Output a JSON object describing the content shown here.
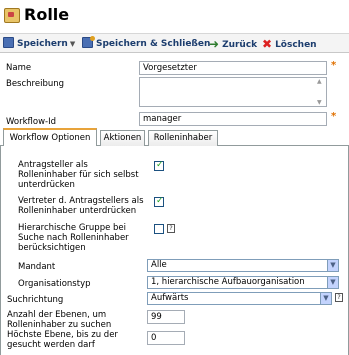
{
  "header": {
    "title": "Rolle"
  },
  "toolbar": {
    "save": "Speichern",
    "save_close": "Speichern & Schließen",
    "back": "Zurück",
    "delete": "Löschen"
  },
  "form": {
    "name_label": "Name",
    "name_value": "Vorgesetzter",
    "description_label": "Beschreibung",
    "description_value": "",
    "workflow_id_label": "Workflow-Id",
    "workflow_id_value": "manager",
    "required_mark": "*"
  },
  "tabs": [
    {
      "label": "Workflow Optionen",
      "active": true
    },
    {
      "label": "Aktionen",
      "active": false
    },
    {
      "label": "Rolleninhaber",
      "active": false
    }
  ],
  "options": {
    "applicant_label": "Antragsteller als Rolleninhaber für sich selbst unterdrücken",
    "applicant_checked": true,
    "deputy_label": "Vertreter d. Antragstellers als Rolleninhaber unterdrücken",
    "deputy_checked": true,
    "hierarchy_label": "Hierarchische Gruppe bei Suche nach Rolleninhaber berücksichtigen",
    "hierarchy_checked": false,
    "help_glyph": "?",
    "mandant_label": "Mandant",
    "mandant_value": "Alle",
    "orgtype_label": "Organisationstyp",
    "orgtype_value": "1, hierarchische Aufbauorganisation",
    "direction_label": "Suchrichtung",
    "direction_value": "Aufwärts",
    "levels_label": "Anzahl der Ebenen, um Rolleninhaber zu suchen",
    "levels_value": "99",
    "highest_label": "Höchste Ebene, bis zu der gesucht werden darf",
    "highest_value": "0"
  },
  "colors": {
    "toolbar_text": "#1c3d6e",
    "required": "#e07000",
    "tab_active_border": "#e8a33a",
    "check": "#21a121"
  }
}
